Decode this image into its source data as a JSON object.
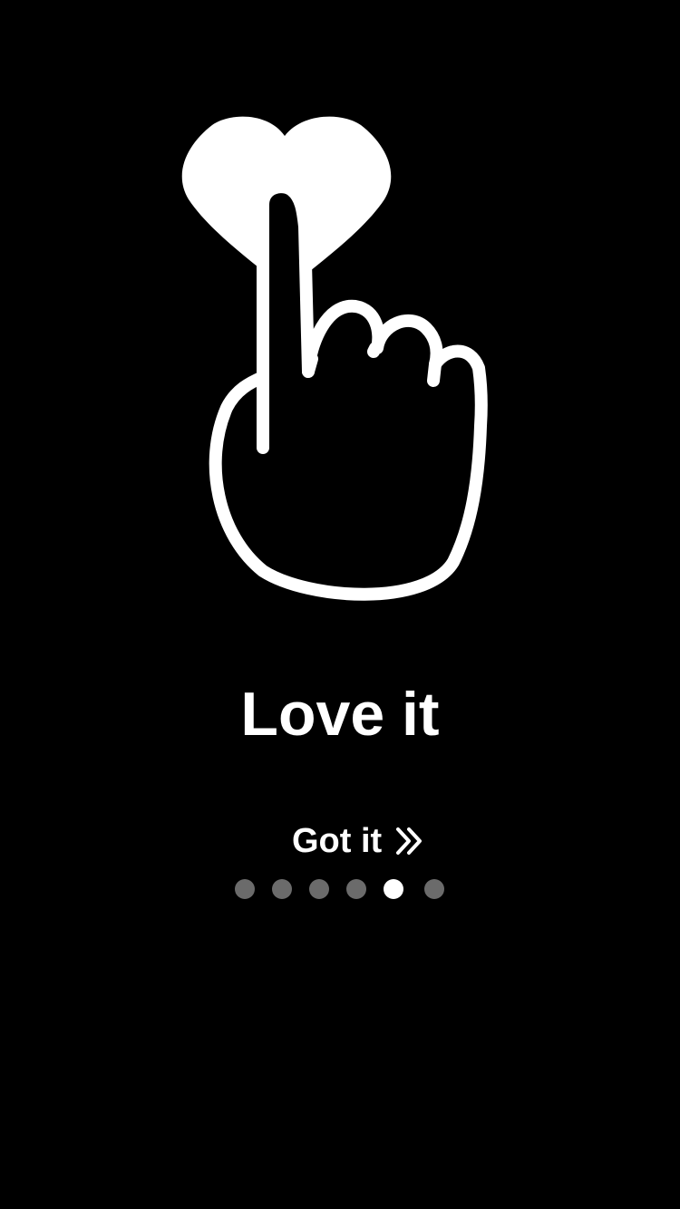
{
  "onboarding": {
    "title": "Love it",
    "got_it_label": "Got it",
    "illustration_icon": "finger-tap-heart-icon",
    "button_icon": "double-chevron-right-icon",
    "page_count": 6,
    "current_page": 5
  },
  "colors": {
    "background": "#000000",
    "foreground": "#ffffff",
    "dot_active": "#ffffff",
    "dot_inactive": "#6b6b6b"
  }
}
